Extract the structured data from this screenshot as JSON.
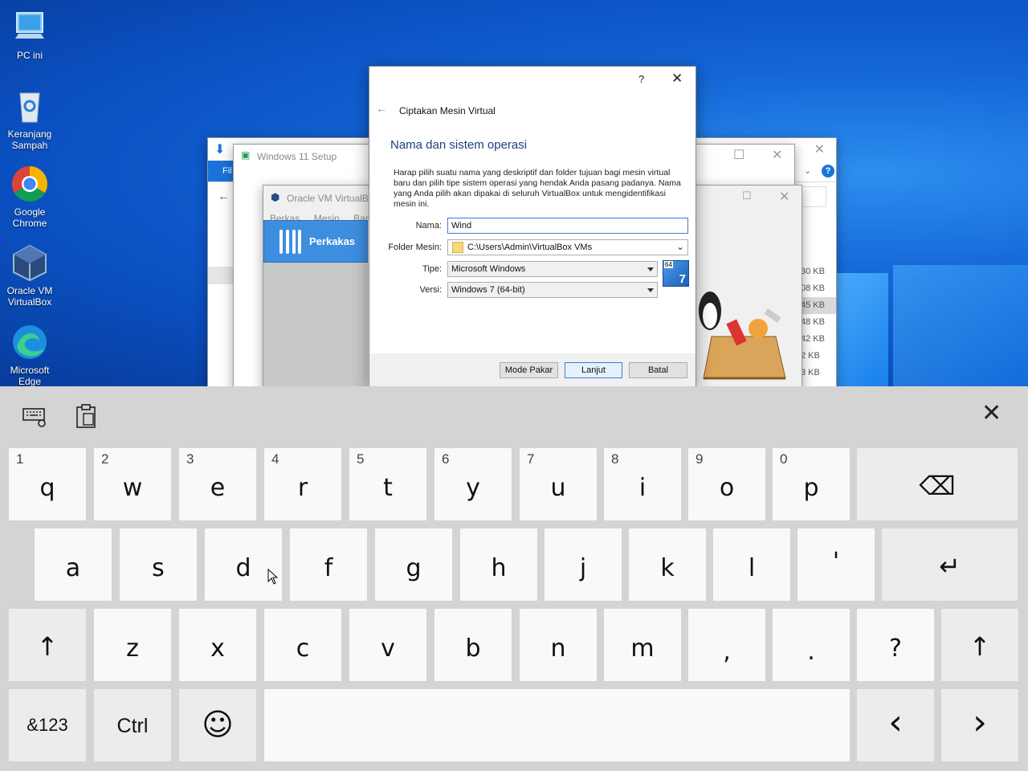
{
  "desktop": {
    "icons": [
      {
        "label": "PC ini",
        "icon": "computer-icon"
      },
      {
        "label": "Keranjang Sampah",
        "icon": "recycle-bin-icon"
      },
      {
        "label": "Google Chrome",
        "icon": "chrome-icon"
      },
      {
        "label": "Oracle VM VirtualBox",
        "icon": "virtualbox-icon"
      },
      {
        "label": "Microsoft Edge",
        "icon": "edge-icon"
      }
    ]
  },
  "explorer": {
    "ribbon_tab": "Fil",
    "sizes": [
      "30 KB",
      "08 KB",
      "45 KB",
      "48 KB",
      "42 KB",
      "2 KB",
      "3 KB"
    ]
  },
  "setup": {
    "title": "Windows 11 Setup"
  },
  "vbox": {
    "title": "Oracle VM VirtualBox",
    "menu": [
      "Berkas",
      "Mesin",
      "Bant"
    ],
    "tools_label": "Perkakas"
  },
  "dialog": {
    "help": "?",
    "header": "Ciptakan Mesin Virtual",
    "heading": "Nama dan sistem operasi",
    "description": "Harap pilih suatu nama yang deskriptif dan folder tujuan bagi mesin virtual baru dan pilih tipe sistem operasi yang hendak Anda pasang padanya. Nama yang Anda pilih akan dipakai di seluruh VirtualBox untuk mengidentifikasi mesin ini.",
    "name_label": "Nama:",
    "name_value": "Wind",
    "folder_label": "Folder Mesin:",
    "folder_value": "C:\\Users\\Admin\\VirtualBox VMs",
    "type_label": "Tipe:",
    "type_value": "Microsoft Windows",
    "version_label": "Versi:",
    "version_value": "Windows 7 (64-bit)",
    "os_badge_bits": "64",
    "os_badge_ver": "7",
    "btn_expert": "Mode Pakar",
    "btn_next": "Lanjut",
    "btn_cancel": "Batal"
  },
  "keyboard": {
    "row1": [
      {
        "num": "1",
        "ch": "q"
      },
      {
        "num": "2",
        "ch": "w"
      },
      {
        "num": "3",
        "ch": "e"
      },
      {
        "num": "4",
        "ch": "r"
      },
      {
        "num": "5",
        "ch": "t"
      },
      {
        "num": "6",
        "ch": "y"
      },
      {
        "num": "7",
        "ch": "u"
      },
      {
        "num": "8",
        "ch": "i"
      },
      {
        "num": "9",
        "ch": "o"
      },
      {
        "num": "0",
        "ch": "p"
      }
    ],
    "row2": [
      "a",
      "s",
      "d",
      "f",
      "g",
      "h",
      "j",
      "k",
      "l",
      "'"
    ],
    "row3": [
      "z",
      "x",
      "c",
      "v",
      "b",
      "n",
      "m",
      ",",
      ".",
      "?"
    ],
    "symbols_key": "&123",
    "ctrl_key": "Ctrl",
    "emoji_key": "☺",
    "backspace": "⌫",
    "enter": "↵",
    "shift": "↑",
    "left": "‹",
    "right": "›"
  }
}
